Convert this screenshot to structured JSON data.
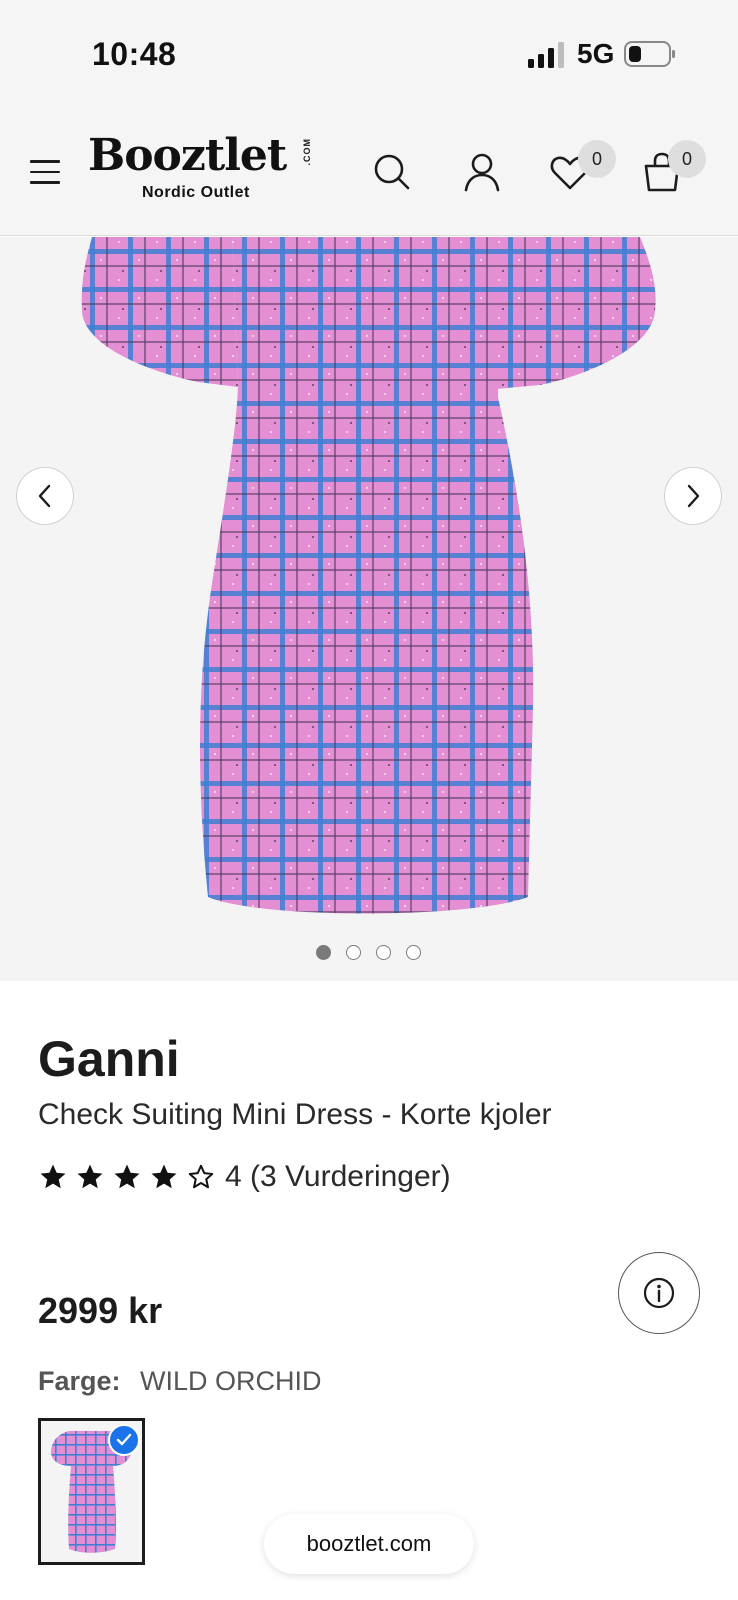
{
  "status_bar": {
    "time": "10:48",
    "network": "5G"
  },
  "header": {
    "logo_text": "Booztlet",
    "logo_com": ".COM",
    "logo_subtitle": "Nordic Outlet",
    "wishlist_count": "0",
    "cart_count": "0",
    "icons": [
      "menu-icon",
      "search-icon",
      "account-icon",
      "heart-icon",
      "bag-icon"
    ]
  },
  "gallery": {
    "image_count": 4,
    "active_index": 0
  },
  "product": {
    "brand": "Ganni",
    "name": "Check Suiting Mini Dress - Korte kjoler",
    "rating_value": 4,
    "rating_text": "4 (3 Vurderinger)",
    "price": "2999 kr",
    "color_label": "Farge:",
    "color_value": "WILD ORCHID"
  },
  "browser": {
    "url": "booztlet.com"
  },
  "colors": {
    "accent": "#1a73e8",
    "dress_pink": "#e48ed3",
    "check_blue": "#3f7fd4"
  }
}
